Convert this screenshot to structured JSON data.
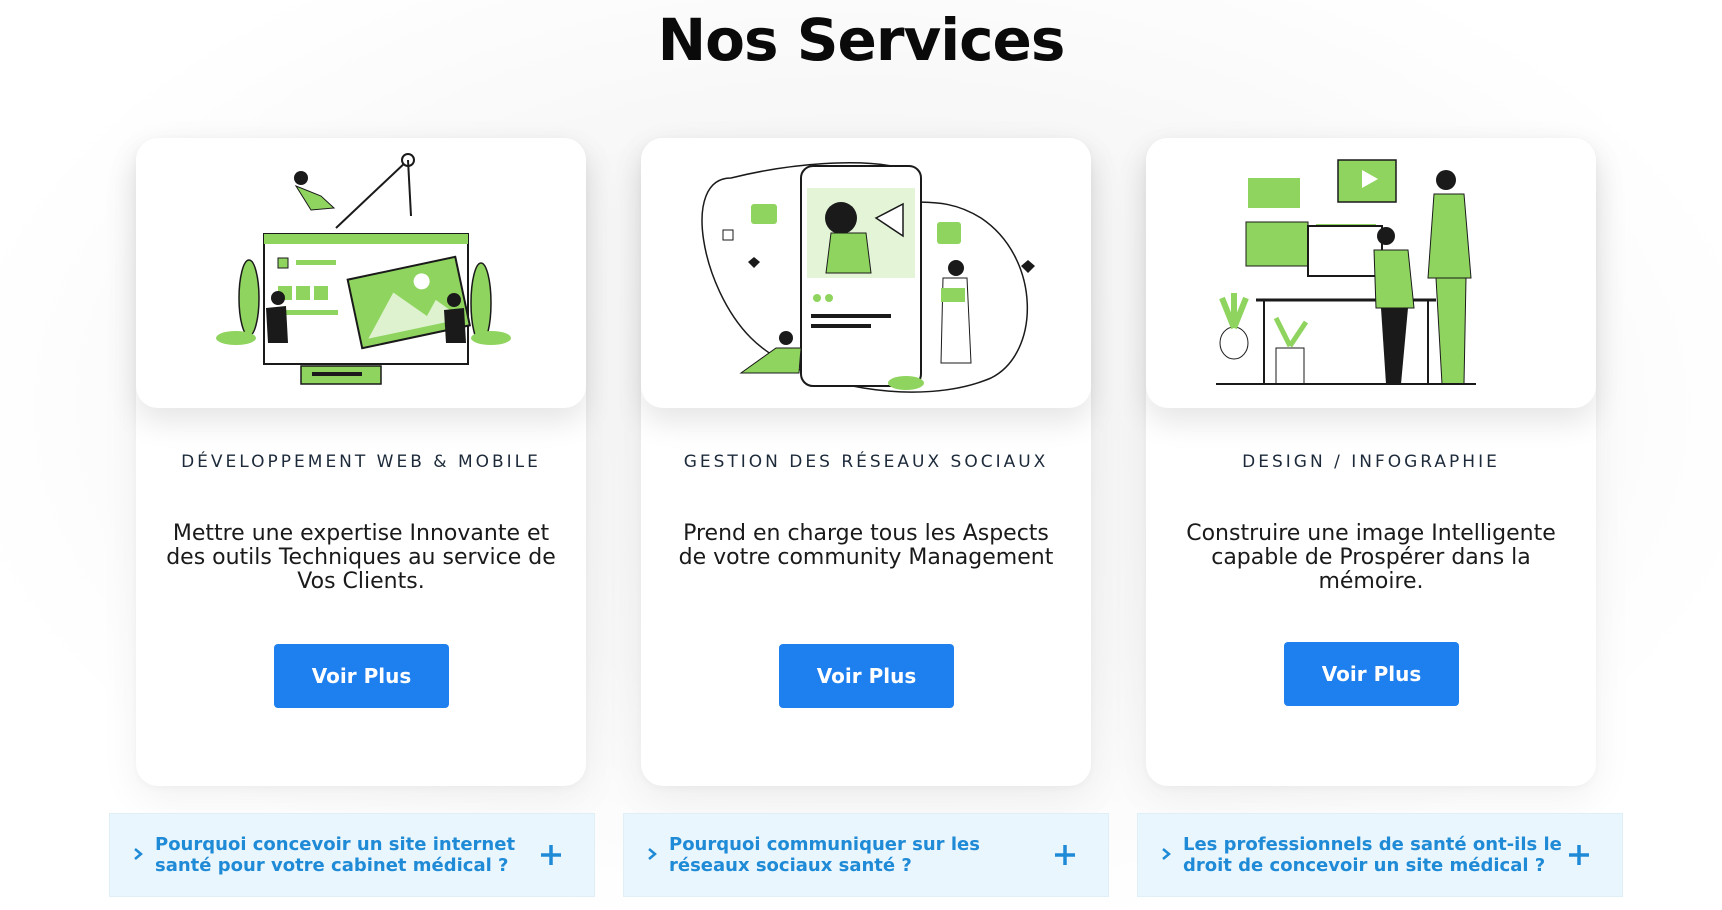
{
  "page": {
    "title": "Nos Services"
  },
  "cards": [
    {
      "illustration": "web-development-illustration",
      "heading": "Développement web & mobile",
      "description": "Mettre une expertise Innovante et des outils Techniques au service de Vos Clients.",
      "button": "Voir Plus"
    },
    {
      "illustration": "social-media-illustration",
      "heading": "Gestion des réseaux sociaux",
      "description": "Prend en charge tous les Aspects de votre community Management",
      "button": "Voir Plus"
    },
    {
      "illustration": "design-infographics-illustration",
      "heading": "Design / Infographie",
      "description": "Construire une image Intelligente capable de Prospérer dans la mémoire.",
      "button": "Voir Plus"
    }
  ],
  "faq": [
    {
      "question": "Pourquoi concevoir un site internet santé pour votre cabinet médical ?",
      "chevron_icon": "chevron-right-icon",
      "toggle_icon": "plus-icon"
    },
    {
      "question": "Pourquoi communiquer sur les réseaux sociaux santé ?",
      "chevron_icon": "chevron-right-icon",
      "toggle_icon": "plus-icon"
    },
    {
      "question": "Les professionnels de santé ont-ils le droit de concevoir un site médical ?",
      "chevron_icon": "chevron-right-icon",
      "toggle_icon": "plus-icon"
    }
  ],
  "colors": {
    "accent_blue": "#1e7fef",
    "faq_text": "#1f8ad6",
    "faq_bg": "#eaf6fd",
    "illustration_green": "#8fd45e"
  }
}
